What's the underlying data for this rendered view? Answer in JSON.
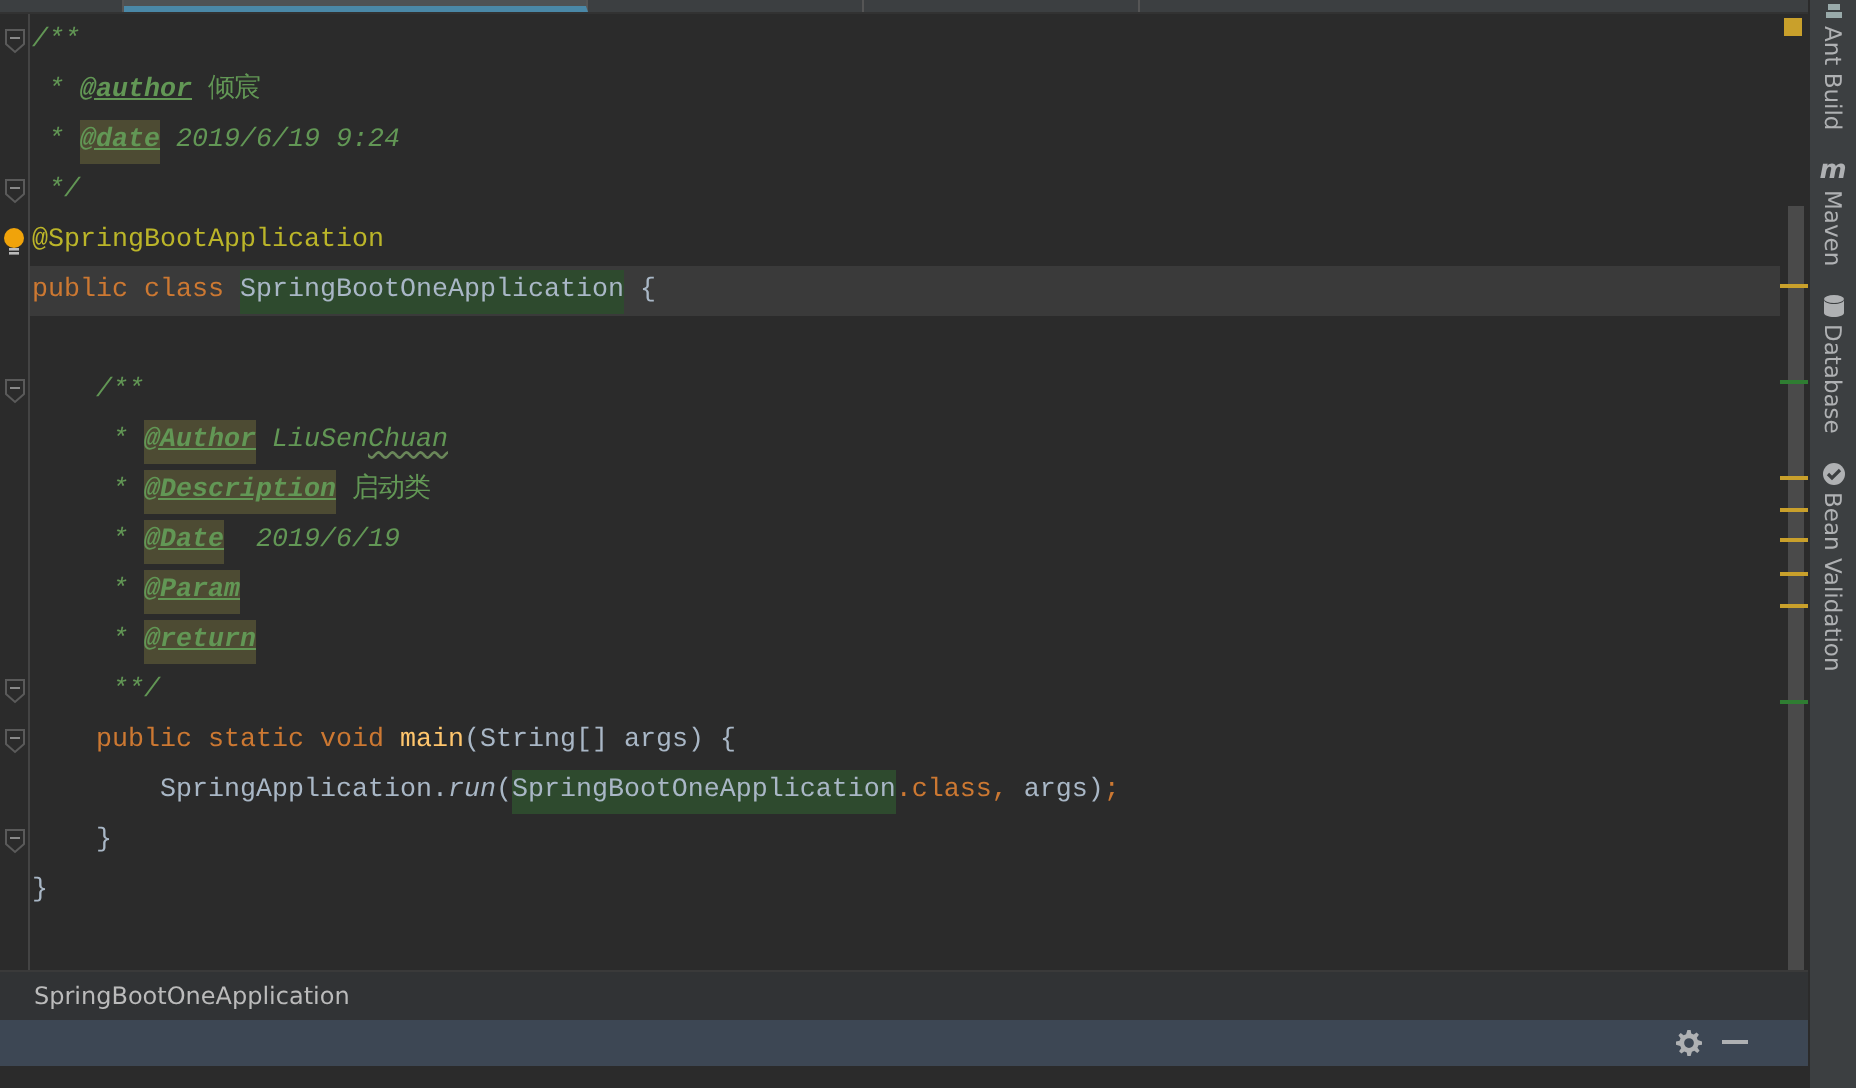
{
  "tabs": [
    {
      "selected": false
    },
    {
      "selected": true
    },
    {
      "selected": false
    },
    {
      "selected": false
    }
  ],
  "editor": {
    "lines": [
      {
        "fold": true,
        "current": false,
        "tokens": [
          {
            "text": "/**",
            "kind": "comment"
          }
        ]
      },
      {
        "fold": false,
        "current": false,
        "tokens": [
          {
            "text": " * ",
            "kind": "comment"
          },
          {
            "text": "@author",
            "kind": "doctag",
            "highlight": false
          },
          {
            "text": " 倾宸",
            "kind": "comment-plain"
          }
        ]
      },
      {
        "fold": false,
        "current": false,
        "tokens": [
          {
            "text": " * ",
            "kind": "comment"
          },
          {
            "text": "@date",
            "kind": "doctag",
            "highlight": true
          },
          {
            "text": " 2019/6/19 9:24",
            "kind": "comment"
          }
        ]
      },
      {
        "fold": true,
        "current": false,
        "tokens": [
          {
            "text": " */",
            "kind": "comment"
          }
        ]
      },
      {
        "fold": false,
        "current": false,
        "bulb": true,
        "tokens": [
          {
            "text": "@SpringBootApplication",
            "kind": "annotation"
          }
        ]
      },
      {
        "fold": false,
        "current": true,
        "tokens": [
          {
            "text": "public class ",
            "kind": "keyword"
          },
          {
            "text": "SpringBootOneApplication",
            "kind": "plain",
            "highlight": true
          },
          {
            "text": " {",
            "kind": "plain"
          }
        ]
      },
      {
        "fold": false,
        "current": false
      },
      {
        "fold": true,
        "current": false,
        "tokens": [
          {
            "text": "    /**",
            "kind": "comment"
          }
        ]
      },
      {
        "fold": false,
        "current": false,
        "tokens": [
          {
            "text": "     * ",
            "kind": "comment"
          },
          {
            "text": "@Author",
            "kind": "doctag",
            "highlight": true
          },
          {
            "text": " LiuSen",
            "kind": "comment"
          },
          {
            "text": "Chuan",
            "kind": "comment",
            "typo": true
          }
        ]
      },
      {
        "fold": false,
        "current": false,
        "tokens": [
          {
            "text": "     * ",
            "kind": "comment"
          },
          {
            "text": "@Description",
            "kind": "doctag",
            "highlight": true
          },
          {
            "text": " 启动类",
            "kind": "comment-plain"
          }
        ]
      },
      {
        "fold": false,
        "current": false,
        "tokens": [
          {
            "text": "     * ",
            "kind": "comment"
          },
          {
            "text": "@Date",
            "kind": "doctag",
            "highlight": true
          },
          {
            "text": "  2019/6/19",
            "kind": "comment"
          }
        ]
      },
      {
        "fold": false,
        "current": false,
        "tokens": [
          {
            "text": "     * ",
            "kind": "comment"
          },
          {
            "text": "@Param",
            "kind": "doctag",
            "highlight": true
          }
        ]
      },
      {
        "fold": false,
        "current": false,
        "tokens": [
          {
            "text": "     * ",
            "kind": "comment"
          },
          {
            "text": "@return",
            "kind": "doctag",
            "highlight": true
          }
        ]
      },
      {
        "fold": true,
        "current": false,
        "tokens": [
          {
            "text": "     **/",
            "kind": "comment"
          }
        ]
      },
      {
        "fold": true,
        "current": false,
        "tokens": [
          {
            "text": "    public static void ",
            "kind": "keyword"
          },
          {
            "text": "main",
            "kind": "method"
          },
          {
            "text": "(String[] args) {",
            "kind": "plain"
          }
        ]
      },
      {
        "fold": false,
        "current": false,
        "tokens": [
          {
            "text": "        SpringApplication.",
            "kind": "plain"
          },
          {
            "text": "run",
            "kind": "static-call"
          },
          {
            "text": "(",
            "kind": "plain"
          },
          {
            "text": "SpringBootOneApplication",
            "kind": "plain",
            "highlight": true
          },
          {
            "text": ".class, ",
            "kind": "keyword"
          },
          {
            "text": "args)",
            "kind": "plain"
          },
          {
            "text": ";",
            "kind": "keyword"
          }
        ]
      },
      {
        "fold": true,
        "current": false,
        "tokens": [
          {
            "text": "    }",
            "kind": "plain"
          }
        ]
      },
      {
        "fold": false,
        "current": false,
        "tokens": [
          {
            "text": "}",
            "kind": "plain"
          }
        ]
      }
    ]
  },
  "breadcrumb": "SpringBootOneApplication",
  "tool_windows": [
    {
      "label": "Ant Build",
      "kind": "ant"
    },
    {
      "label": "Maven",
      "kind": "maven",
      "icon": "m"
    },
    {
      "label": "Database",
      "kind": "database"
    },
    {
      "label": "Bean Validation",
      "kind": "bean"
    }
  ]
}
